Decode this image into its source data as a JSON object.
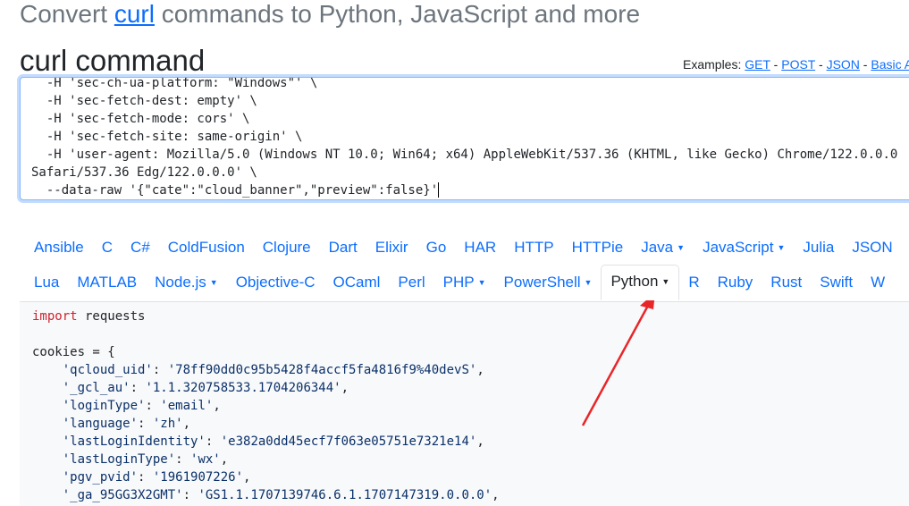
{
  "header": {
    "prefix": "Convert ",
    "link": "curl",
    "suffix": " commands to Python, JavaScript and more"
  },
  "section_title": "curl command",
  "examples": {
    "label": "Examples: ",
    "links": [
      "GET",
      "POST",
      "JSON",
      "Basic A"
    ],
    "sep": " - "
  },
  "curl_lines": [
    "  -H 'sec-ch-ua-platform: \"Windows\"' \\",
    "  -H 'sec-fetch-dest: empty' \\",
    "  -H 'sec-fetch-mode: cors' \\",
    "  -H 'sec-fetch-site: same-origin' \\",
    "  -H 'user-agent: Mozilla/5.0 (Windows NT 10.0; Win64; x64) AppleWebKit/537.36 (KHTML, like Gecko) Chrome/122.0.0.0",
    "Safari/537.36 Edg/122.0.0.0' \\",
    "  --data-raw '{\"cate\":\"cloud_banner\",\"preview\":false}'"
  ],
  "tabs_row1": [
    {
      "label": "Ansible",
      "dropdown": false
    },
    {
      "label": "C",
      "dropdown": false
    },
    {
      "label": "C#",
      "dropdown": false
    },
    {
      "label": "ColdFusion",
      "dropdown": false
    },
    {
      "label": "Clojure",
      "dropdown": false
    },
    {
      "label": "Dart",
      "dropdown": false
    },
    {
      "label": "Elixir",
      "dropdown": false
    },
    {
      "label": "Go",
      "dropdown": false
    },
    {
      "label": "HAR",
      "dropdown": false
    },
    {
      "label": "HTTP",
      "dropdown": false
    },
    {
      "label": "HTTPie",
      "dropdown": false
    },
    {
      "label": "Java",
      "dropdown": true
    },
    {
      "label": "JavaScript",
      "dropdown": true
    },
    {
      "label": "Julia",
      "dropdown": false
    },
    {
      "label": "JSON",
      "dropdown": false
    }
  ],
  "tabs_row2": [
    {
      "label": "Lua",
      "dropdown": false
    },
    {
      "label": "MATLAB",
      "dropdown": false
    },
    {
      "label": "Node.js",
      "dropdown": true
    },
    {
      "label": "Objective-C",
      "dropdown": false
    },
    {
      "label": "OCaml",
      "dropdown": false
    },
    {
      "label": "Perl",
      "dropdown": false
    },
    {
      "label": "PHP",
      "dropdown": true
    },
    {
      "label": "PowerShell",
      "dropdown": true
    },
    {
      "label": "Python",
      "dropdown": true,
      "active": true
    },
    {
      "label": "R",
      "dropdown": false
    },
    {
      "label": "Ruby",
      "dropdown": false
    },
    {
      "label": "Rust",
      "dropdown": false
    },
    {
      "label": "Swift",
      "dropdown": false
    },
    {
      "label": "W",
      "dropdown": false
    }
  ],
  "code": {
    "import_kw": "import",
    "import_rest": " requests",
    "cookies_open": "cookies = {",
    "cookies": [
      {
        "key": "'qcloud_uid'",
        "value": "'78ff90dd0c95b5428f4accf5fa4816f9%40devS'"
      },
      {
        "key": "'_gcl_au'",
        "value": "'1.1.320758533.1704206344'"
      },
      {
        "key": "'loginType'",
        "value": "'email'"
      },
      {
        "key": "'language'",
        "value": "'zh'"
      },
      {
        "key": "'lastLoginIdentity'",
        "value": "'e382a0dd45ecf7f063e05751e7321e14'"
      },
      {
        "key": "'lastLoginType'",
        "value": "'wx'"
      },
      {
        "key": "'pgv_pvid'",
        "value": "'1961907226'"
      },
      {
        "key": "'_ga_95GG3X2GMT'",
        "value": "'GS1.1.1707139746.6.1.1707147319.0.0.0'"
      }
    ]
  },
  "colors": {
    "link": "#0d6efd",
    "annotation_arrow": "#e8262a"
  }
}
